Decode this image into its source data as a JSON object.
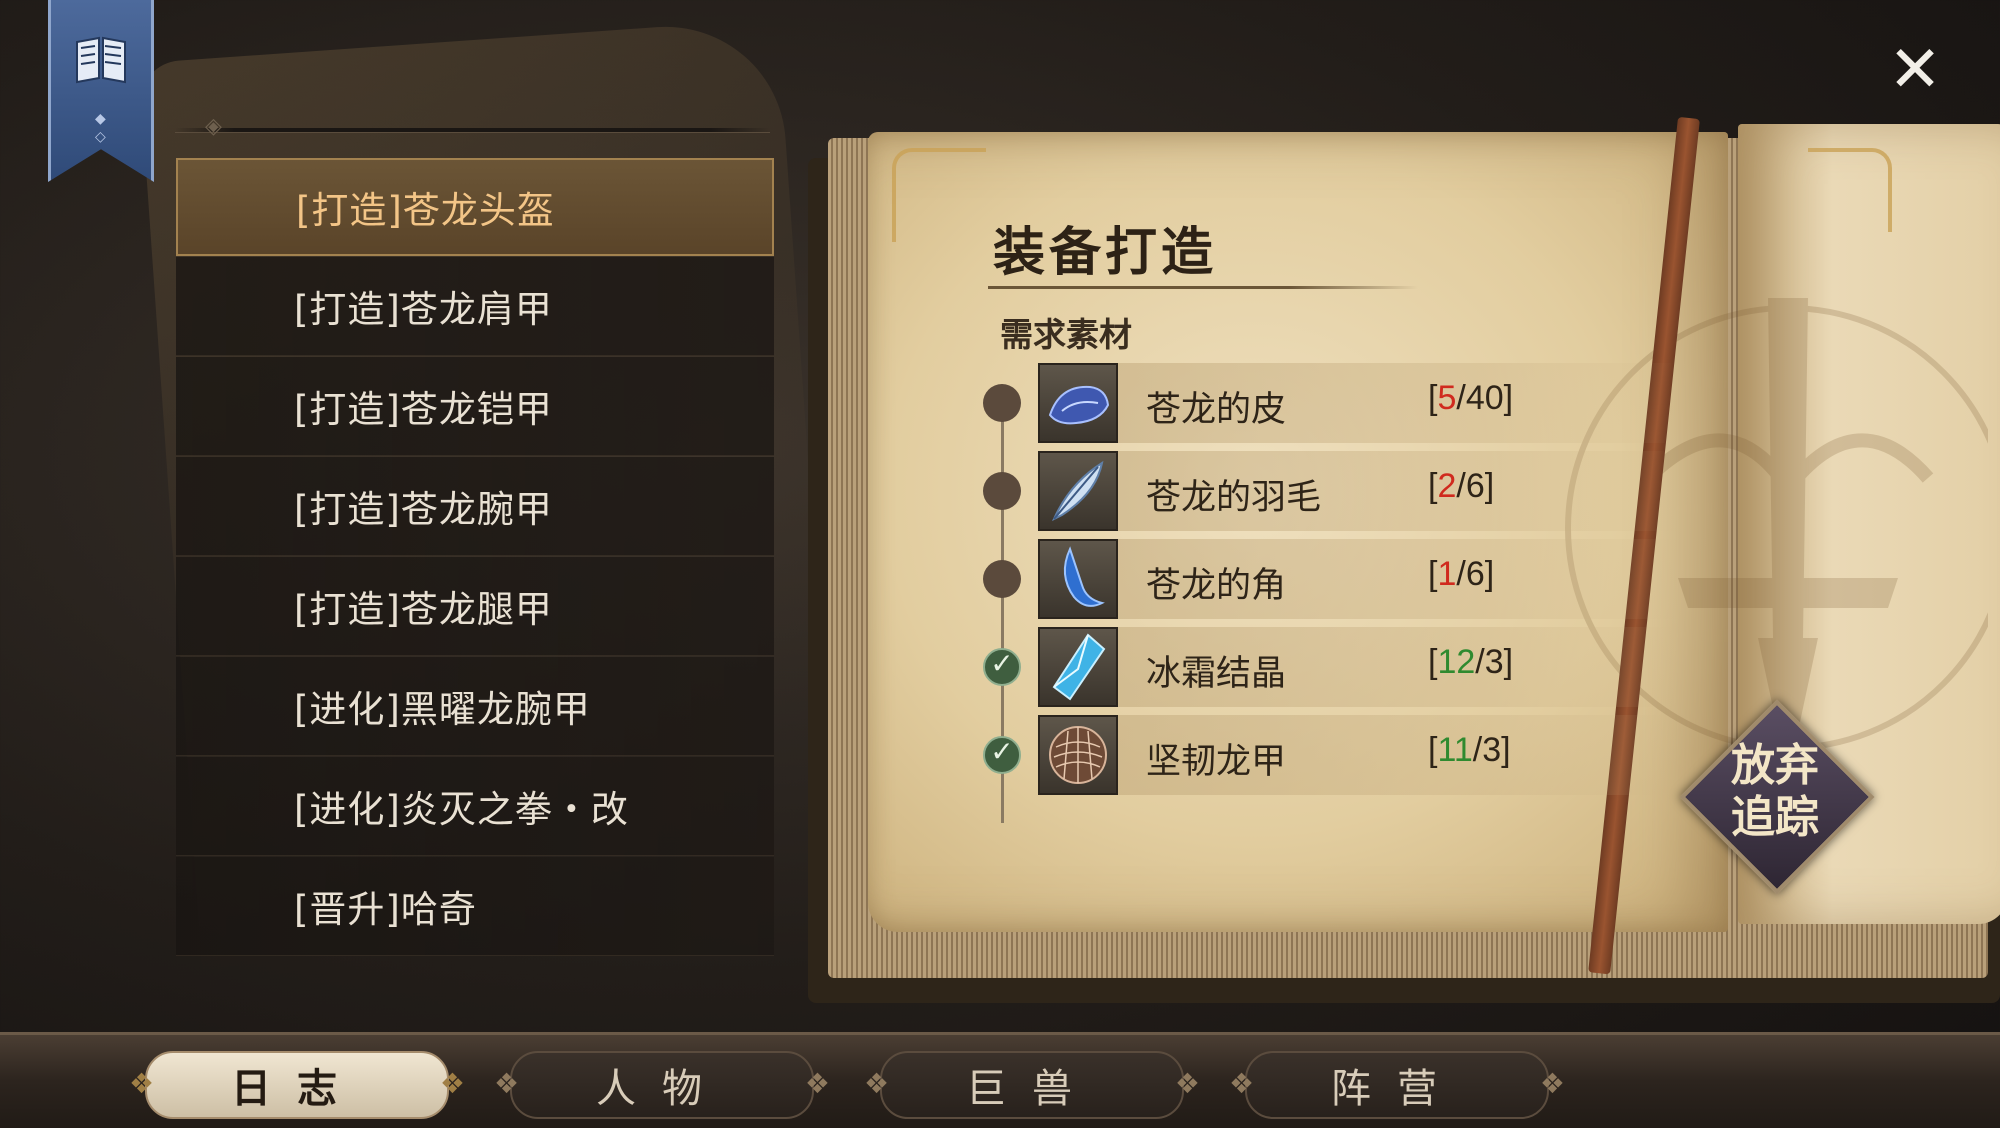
{
  "close_label": "✕",
  "quests": [
    {
      "label": "[打造]苍龙头盔",
      "active": true
    },
    {
      "label": "[打造]苍龙肩甲",
      "active": false
    },
    {
      "label": "[打造]苍龙铠甲",
      "active": false
    },
    {
      "label": "[打造]苍龙腕甲",
      "active": false
    },
    {
      "label": "[打造]苍龙腿甲",
      "active": false
    },
    {
      "label": "[进化]黑曜龙腕甲",
      "active": false
    },
    {
      "label": "[进化]炎灭之拳・改",
      "active": false
    },
    {
      "label": "[晋升]哈奇",
      "active": false
    }
  ],
  "book": {
    "title": "装备打造",
    "section": "需求素材",
    "materials": [
      {
        "name": "苍龙的皮",
        "have": "5",
        "need": "40",
        "complete": false,
        "icon": "dragon-hide-icon"
      },
      {
        "name": "苍龙的羽毛",
        "have": "2",
        "need": "6",
        "complete": false,
        "icon": "feather-icon"
      },
      {
        "name": "苍龙的角",
        "have": "1",
        "need": "6",
        "complete": false,
        "icon": "dragon-horn-icon"
      },
      {
        "name": "冰霜结晶",
        "have": "12",
        "need": "3",
        "complete": true,
        "icon": "frost-crystal-icon"
      },
      {
        "name": "坚韧龙甲",
        "have": "11",
        "need": "3",
        "complete": true,
        "icon": "dragon-scale-icon"
      }
    ],
    "abandon_line1": "放弃",
    "abandon_line2": "追踪"
  },
  "tabs": [
    {
      "label": "日志",
      "active": true
    },
    {
      "label": "人物",
      "active": false
    },
    {
      "label": "巨兽",
      "active": false
    },
    {
      "label": "阵营",
      "active": false
    }
  ],
  "colors": {
    "count_insufficient": "#d02a1e",
    "count_sufficient": "#2f8a2f",
    "active_quest_text": "#f3c587"
  }
}
